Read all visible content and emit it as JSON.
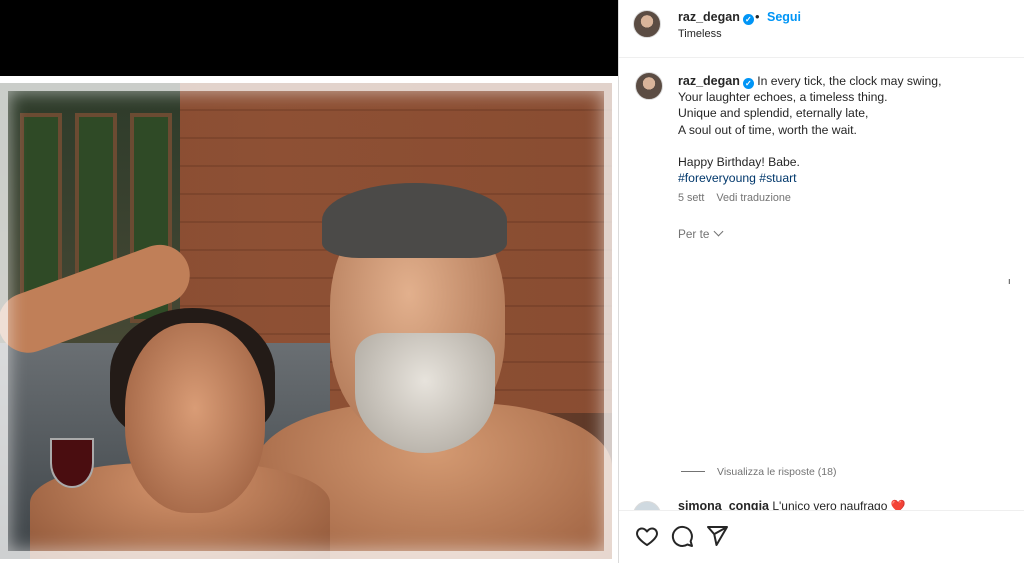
{
  "header": {
    "username": "raz_degan",
    "separator": "•",
    "follow_label": "Segui",
    "subtitle": "Timeless"
  },
  "caption": {
    "username": "raz_degan",
    "lines": [
      "In every tick, the clock may swing,",
      "Your laughter echoes, a timeless thing.",
      "Unique and splendid, eternally late,",
      "A soul out of time, worth the wait.",
      "",
      "Happy Birthday! Babe."
    ],
    "hashtags": "#foreveryoung #stuart",
    "time": "5 sett",
    "translate": "Vedi traduzione"
  },
  "for_you": "Per te",
  "stray_mark": "ı",
  "replies_label": "Visualizza le risposte (18)",
  "comment": {
    "username": "simona_congia",
    "text": "L'unico vero naufrago",
    "emoji": "❤️"
  },
  "icons": {
    "like": "heart-icon",
    "comment": "comment-icon",
    "share": "paper-plane-icon",
    "verified": "verified-badge-icon"
  },
  "colors": {
    "accent": "#0095f6",
    "hashtag": "#00376b",
    "muted": "#737373"
  }
}
